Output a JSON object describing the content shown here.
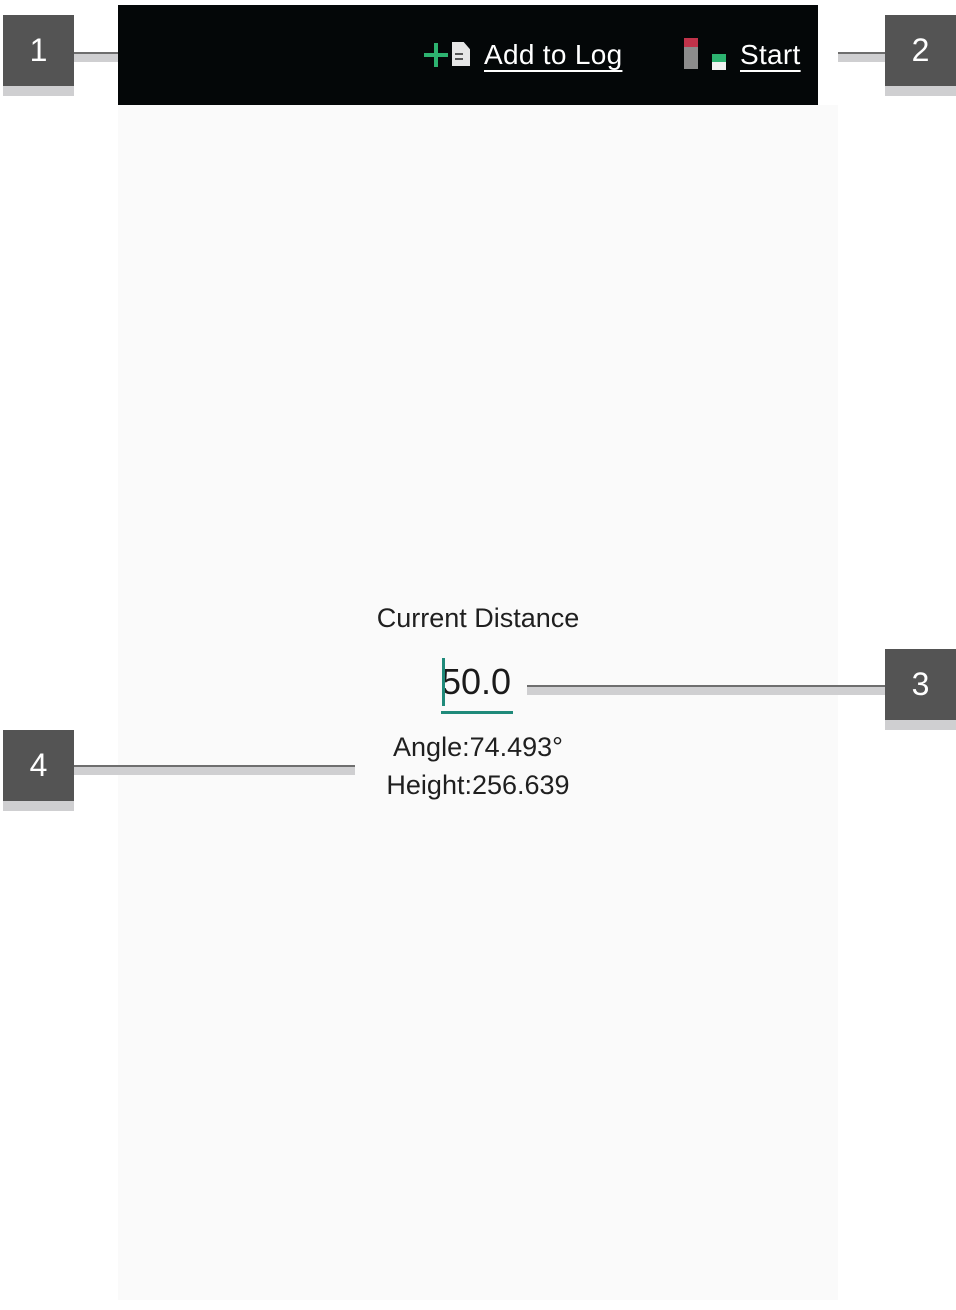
{
  "toolbar": {
    "add_to_log_label": "Add to Log",
    "start_label": "Start"
  },
  "main": {
    "distance_title": "Current Distance",
    "distance_value": "50.0",
    "angle_text": "Angle:74.493°",
    "height_text": "Height:256.639"
  },
  "callouts": [
    "1",
    "2",
    "3",
    "4"
  ],
  "icons": {
    "add_to_log": "add-document-icon",
    "start": "start-indicator-icon"
  },
  "colors": {
    "toolbar_bg": "#040708",
    "accent_teal": "#1f8a7a",
    "green": "#2db370",
    "red": "#c0334a",
    "callout_bg": "#545454"
  }
}
